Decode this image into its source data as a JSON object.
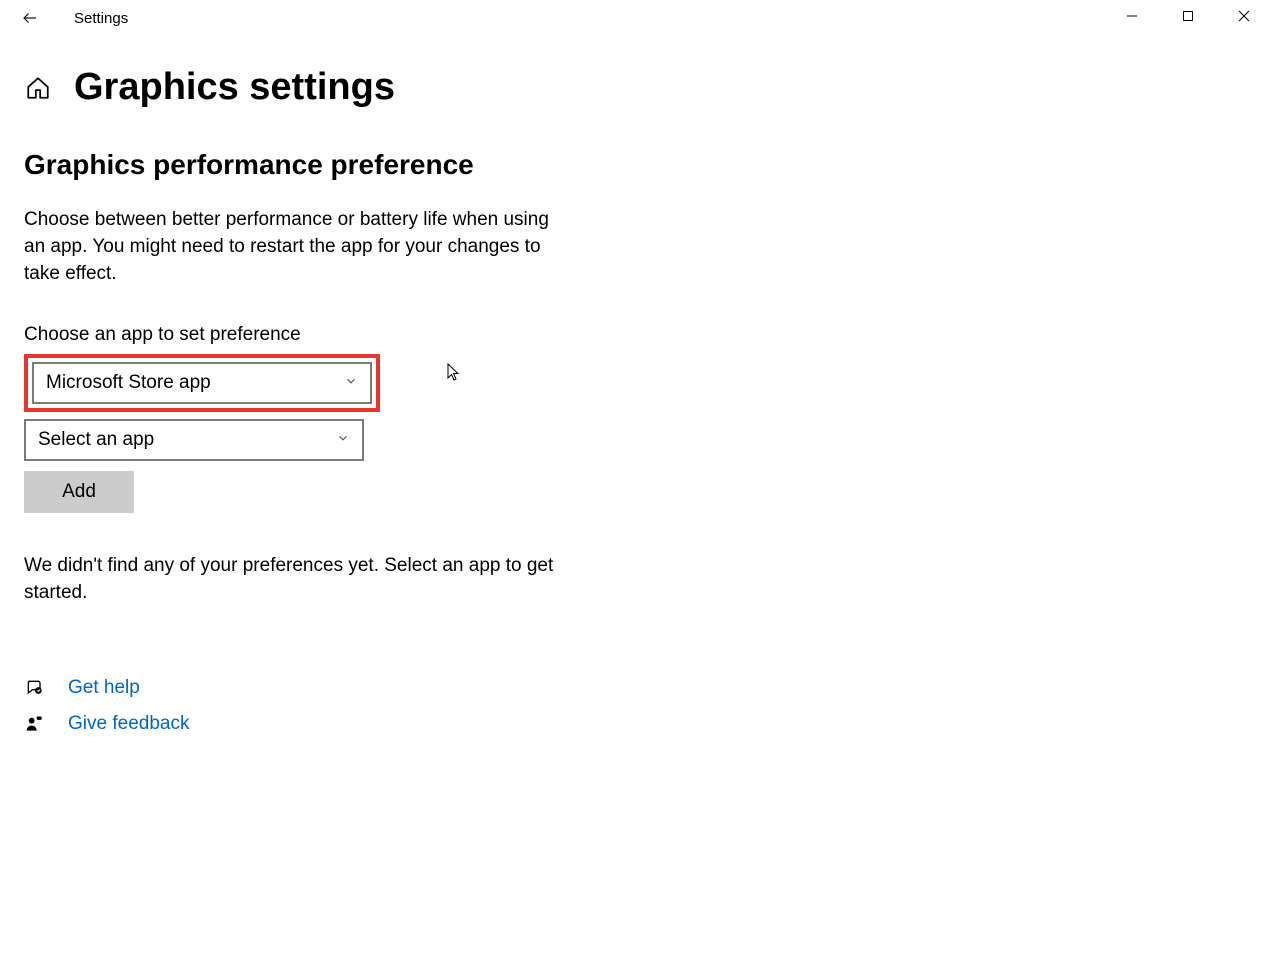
{
  "titlebar": {
    "title": "Settings"
  },
  "page": {
    "heading": "Graphics settings"
  },
  "section": {
    "heading": "Graphics performance preference",
    "description": "Choose between better performance or battery life when using an app. You might need to restart the app for your changes to take effect.",
    "field_label": "Choose an app to set preference",
    "dropdown_app_type": "Microsoft Store app",
    "dropdown_select_app": "Select an app",
    "add_button": "Add",
    "empty_message": "We didn't find any of your preferences yet. Select an app to get started."
  },
  "links": {
    "get_help": "Get help",
    "give_feedback": "Give feedback"
  }
}
